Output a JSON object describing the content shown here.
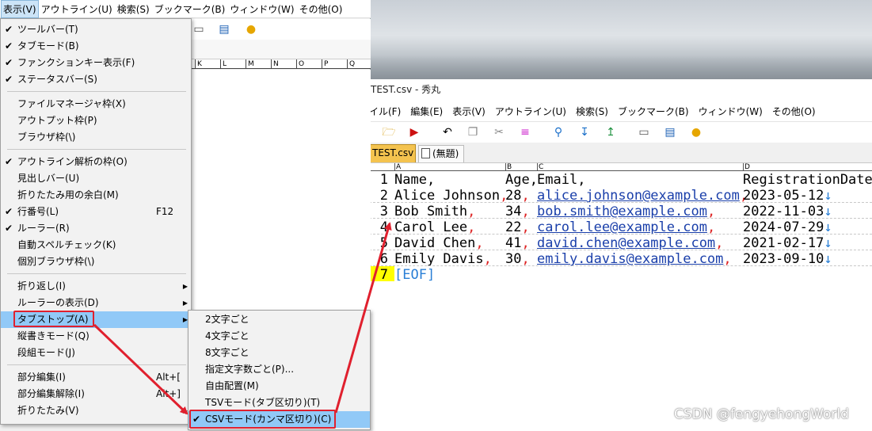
{
  "back_window": {
    "menubar": [
      "表示(V)",
      "アウトライン(U)",
      "検索(S)",
      "ブックマーク(B)",
      "ウィンドウ(W)",
      "その他(O)"
    ],
    "ruler": [
      "K",
      "L",
      "M",
      "N",
      "O",
      "P",
      "Q"
    ]
  },
  "view_menu": {
    "items": [
      {
        "label": "ツールバー(T)",
        "checked": true
      },
      {
        "label": "タブモード(B)",
        "checked": true
      },
      {
        "label": "ファンクションキー表示(F)",
        "checked": true
      },
      {
        "label": "ステータスバー(S)",
        "checked": true
      },
      {
        "sep": true
      },
      {
        "label": "ファイルマネージャ枠(X)"
      },
      {
        "label": "アウトプット枠(P)"
      },
      {
        "label": "ブラウザ枠(\\)"
      },
      {
        "sep": true
      },
      {
        "label": "アウトライン解析の枠(O)",
        "checked": true
      },
      {
        "label": "見出しバー(U)"
      },
      {
        "label": "折りたたみ用の余白(M)"
      },
      {
        "label": "行番号(L)",
        "checked": true,
        "shortcut": "F12"
      },
      {
        "label": "ルーラー(R)",
        "checked": true
      },
      {
        "label": "自動スペルチェック(K)"
      },
      {
        "label": "個別ブラウザ枠(\\)"
      },
      {
        "sep": true
      },
      {
        "label": "折り返し(I)",
        "submenu": true
      },
      {
        "label": "ルーラーの表示(D)",
        "submenu": true
      },
      {
        "label": "タブストップ(A)",
        "submenu": true,
        "highlight": true
      },
      {
        "label": "縦書きモード(Q)"
      },
      {
        "label": "段組モード(J)"
      },
      {
        "sep": true
      },
      {
        "label": "部分編集(I)",
        "shortcut": "Alt+["
      },
      {
        "label": "部分編集解除(I)",
        "shortcut": "Alt+]"
      },
      {
        "label": "折りたたみ(V)",
        "submenu": true
      }
    ]
  },
  "tabstop_submenu": {
    "items": [
      {
        "label": "2文字ごと"
      },
      {
        "label": "4文字ごと"
      },
      {
        "label": "8文字ごと"
      },
      {
        "label": "指定文字数ごと(P)..."
      },
      {
        "label": "自由配置(M)"
      },
      {
        "label": "TSVモード(タブ区切り)(T)"
      },
      {
        "label": "CSVモード(カンマ区切り)(C)",
        "checked": true,
        "highlight": true
      }
    ]
  },
  "front_window": {
    "title": "TEST.csv  - 秀丸",
    "menubar": [
      "イル(F)",
      "編集(E)",
      "表示(V)",
      "アウトライン(U)",
      "検索(S)",
      "ブックマーク(B)",
      "ウィンドウ(W)",
      "その他(O)"
    ],
    "tabs": [
      "TEST.csv",
      "(無題)"
    ],
    "ruler": [
      "A",
      "B",
      "C",
      "D"
    ],
    "rows": [
      {
        "ln": "1",
        "a": "Name",
        "b": "Age",
        "c": "Email",
        "d": "RegistrationDate"
      },
      {
        "ln": "2",
        "a": "Alice Johnson",
        "b": "28",
        "c": "alice.johnson@example.com",
        "d": "2023-05-12"
      },
      {
        "ln": "3",
        "a": "Bob Smith",
        "b": "34",
        "c": "bob.smith@example.com",
        "d": "2022-11-03"
      },
      {
        "ln": "4",
        "a": "Carol Lee",
        "b": "22",
        "c": "carol.lee@example.com",
        "d": "2024-07-29"
      },
      {
        "ln": "5",
        "a": "David Chen",
        "b": "41",
        "c": "david.chen@example.com",
        "d": "2021-02-17"
      },
      {
        "ln": "6",
        "a": "Emily Davis",
        "b": "30",
        "c": "emily.davis@example.com",
        "d": "2023-09-10"
      }
    ],
    "eof_line": "7",
    "eof_text": "[EOF]",
    "comma": ",",
    "crlf": "↓"
  },
  "watermark": "CSDN @fengyehongWorld",
  "colors": {
    "highlight": "#91c9f7",
    "annotation_red": "#e0202e",
    "tab_active": "#f4c34f",
    "link": "#1a3faa"
  }
}
